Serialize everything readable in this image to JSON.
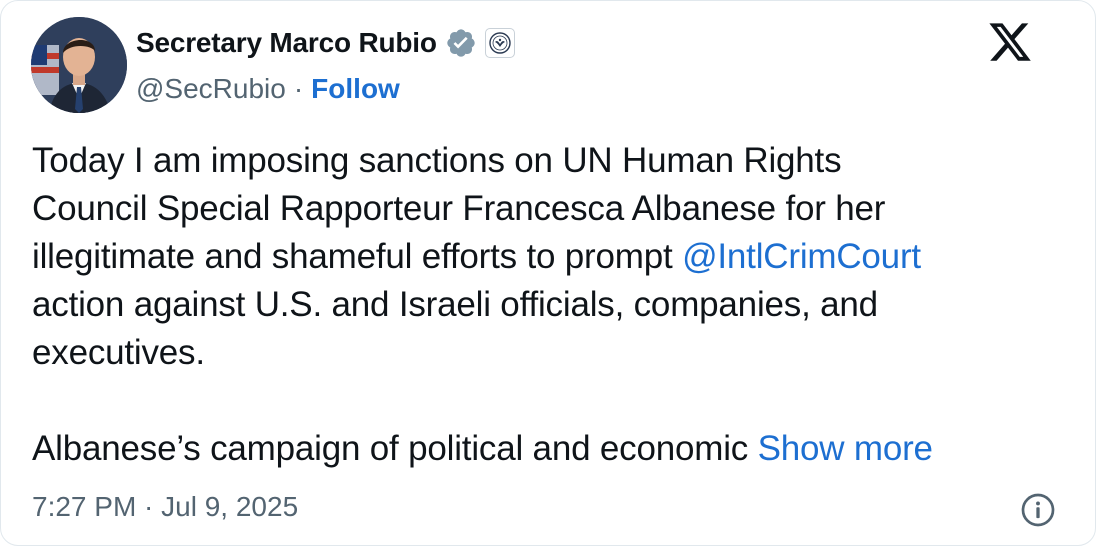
{
  "author": {
    "name": "Secretary Marco Rubio",
    "handle": "@SecRubio",
    "separator": "·",
    "follow_label": "Follow",
    "verified_icon": "verified-badge-icon",
    "affiliation_icon": "state-department-seal-icon"
  },
  "tweet": {
    "lines": [
      "Today I am imposing sanctions on UN Human Rights",
      "Council Special Rapporteur Francesca Albanese for her"
    ],
    "line3_before_mention": "illegitimate and shameful efforts to prompt ",
    "mention": "@IntlCrimCourt",
    "line4": "action against U.S. and Israeli officials, companies, and",
    "line5": "executives.",
    "second_paragraph": "Albanese’s campaign of political and economic ",
    "show_more_label": "Show more"
  },
  "meta": {
    "timestamp": "7:27 PM · Jul 9, 2025"
  },
  "colors": {
    "link": "#1d6fd1",
    "text": "#0f1419",
    "secondary": "#536471",
    "verified": "#829aab"
  }
}
